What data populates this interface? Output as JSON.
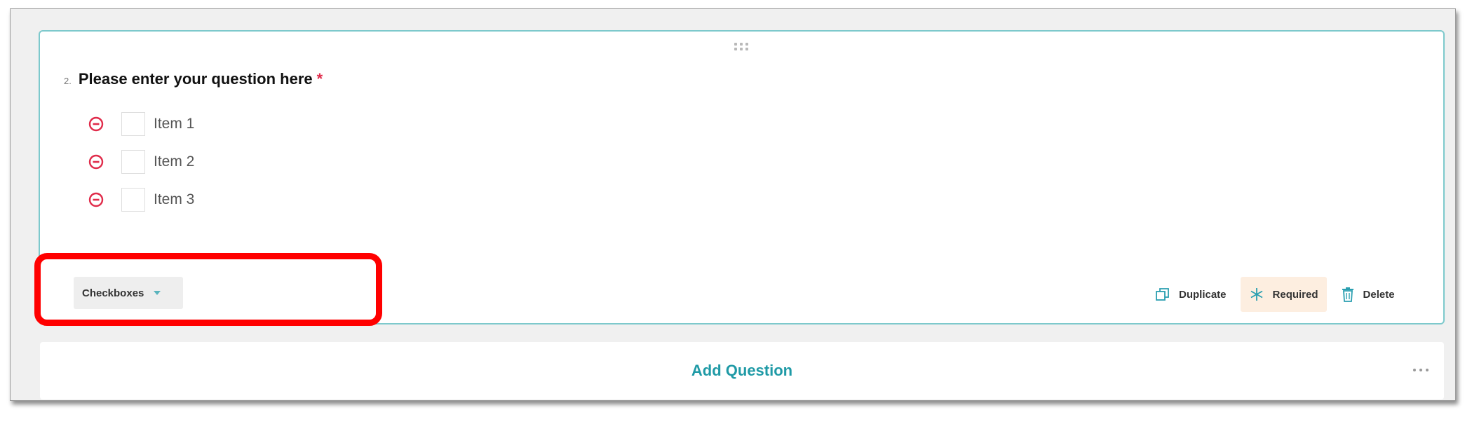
{
  "question": {
    "number": "2.",
    "title": "Please enter your question here",
    "required_marker": "*",
    "options": [
      {
        "label": "Item 1"
      },
      {
        "label": "Item 2"
      },
      {
        "label": "Item 3"
      }
    ],
    "type_select": {
      "selected": "Checkboxes"
    },
    "actions": {
      "duplicate": "Duplicate",
      "required": "Required",
      "delete": "Delete"
    }
  },
  "add_question": {
    "label": "Add Question"
  },
  "colors": {
    "accent_teal": "#1f9aa6",
    "card_border": "#7dc9cc",
    "remove_red": "#e02b4a",
    "highlight_red": "#ff0000",
    "required_bg": "#fdeee0"
  },
  "icons": {
    "drag": "drag-handle-icon",
    "remove": "minus-circle-icon",
    "dropdown": "chevron-down-icon",
    "duplicate": "copy-icon",
    "required": "asterisk-icon",
    "delete": "trash-icon",
    "more": "more-horizontal-icon"
  }
}
